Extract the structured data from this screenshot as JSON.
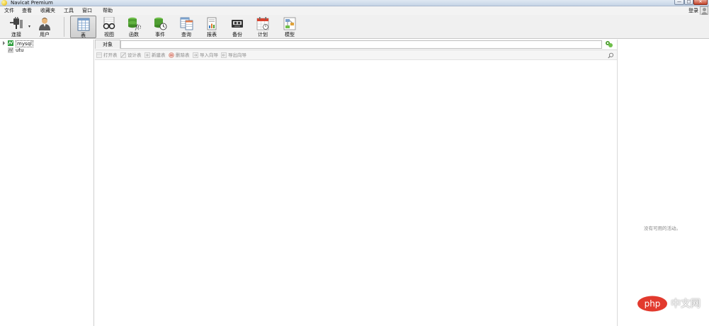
{
  "window": {
    "title": "Navicat Premium",
    "min_glyph": "—",
    "max_glyph": "□",
    "close_glyph": "✕"
  },
  "menu": {
    "items": [
      "文件",
      "查看",
      "收藏夹",
      "工具",
      "窗口",
      "帮助"
    ],
    "login": "登录"
  },
  "toolbar": {
    "buttons": [
      {
        "label": "连接",
        "icon": "connection-plug-icon"
      },
      {
        "label": "用户",
        "icon": "user-person-icon"
      },
      {
        "label": "表",
        "icon": "table-grid-icon",
        "active": true
      },
      {
        "label": "视图",
        "icon": "view-glasses-icon"
      },
      {
        "label": "函数",
        "icon": "function-fx-icon"
      },
      {
        "label": "事件",
        "icon": "event-clock-icon"
      },
      {
        "label": "查询",
        "icon": "query-table-icon"
      },
      {
        "label": "报表",
        "icon": "report-chart-icon"
      },
      {
        "label": "备份",
        "icon": "backup-tape-icon"
      },
      {
        "label": "计划",
        "icon": "schedule-calendar-icon"
      },
      {
        "label": "模型",
        "icon": "model-diagram-icon"
      }
    ]
  },
  "nav": {
    "connections": [
      {
        "name": "mysql",
        "expanded": false,
        "selected": true,
        "color": "#2e9e3e"
      },
      {
        "name": "utu",
        "expanded": false,
        "selected": false,
        "color": "#9a9a9a"
      }
    ]
  },
  "main": {
    "object_tab": "对象",
    "filter_value": "",
    "object_actions": [
      "打开表",
      "设计表",
      "新建表",
      "删除表",
      "导入向导",
      "导出向导"
    ]
  },
  "info_panel": {
    "message": "没有可用的活动。"
  },
  "watermark": {
    "logo_text": "php",
    "site_text": "中文网"
  },
  "colors": {
    "accent_green": "#2e9e3e",
    "toolbar_bg": "#f0f0f0",
    "disabled_text": "#8a8a8a"
  }
}
